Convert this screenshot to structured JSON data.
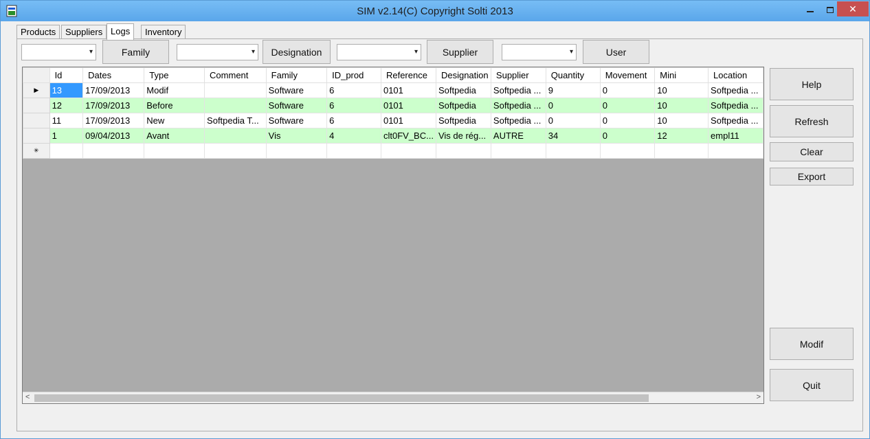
{
  "window": {
    "title": "SIM v2.14(C) Copyright Solti 2013",
    "min": "–",
    "close": "✕"
  },
  "tabs": [
    {
      "label": "Products"
    },
    {
      "label": "Suppliers"
    },
    {
      "label": "Logs"
    },
    {
      "label": "Inventory"
    }
  ],
  "filters": {
    "family_button": "Family",
    "designation_button": "Designation",
    "supplier_button": "Supplier",
    "user_button": "User",
    "combo_arrow": "▾"
  },
  "grid": {
    "columns": [
      "Id",
      "Dates",
      "Type",
      "Comment",
      "Family",
      "ID_prod",
      "Reference",
      "Designation",
      "Supplier",
      "Quantity",
      "Movement",
      "Mini",
      "Location"
    ],
    "rows": [
      {
        "cells": [
          "13",
          "17/09/2013",
          "Modif",
          "",
          "Software",
          "6",
          "0101",
          "Softpedia",
          "Softpedia ...",
          "9",
          "0",
          "10",
          "Softpedia ..."
        ],
        "marker": "▶"
      },
      {
        "cells": [
          "12",
          "17/09/2013",
          "Before",
          "",
          "Software",
          "6",
          "0101",
          "Softpedia",
          "Softpedia ...",
          "0",
          "0",
          "10",
          "Softpedia ..."
        ],
        "marker": ""
      },
      {
        "cells": [
          "11",
          "17/09/2013",
          "New",
          "Softpedia T...",
          "Software",
          "6",
          "0101",
          "Softpedia",
          "Softpedia ...",
          "0",
          "0",
          "10",
          "Softpedia ..."
        ],
        "marker": ""
      },
      {
        "cells": [
          "1",
          "09/04/2013",
          "Avant",
          "",
          "Vis",
          "4",
          "clt0FV_BC...",
          "Vis de rég...",
          "AUTRE",
          "34",
          "0",
          "12",
          "empl11"
        ],
        "marker": ""
      }
    ],
    "new_row_marker": "✳",
    "scroll_left": "<",
    "scroll_right": ">"
  },
  "actions": {
    "help": "Help",
    "refresh": "Refresh",
    "clear": "Clear",
    "export": "Export",
    "modif": "Modif",
    "quit": "Quit"
  }
}
